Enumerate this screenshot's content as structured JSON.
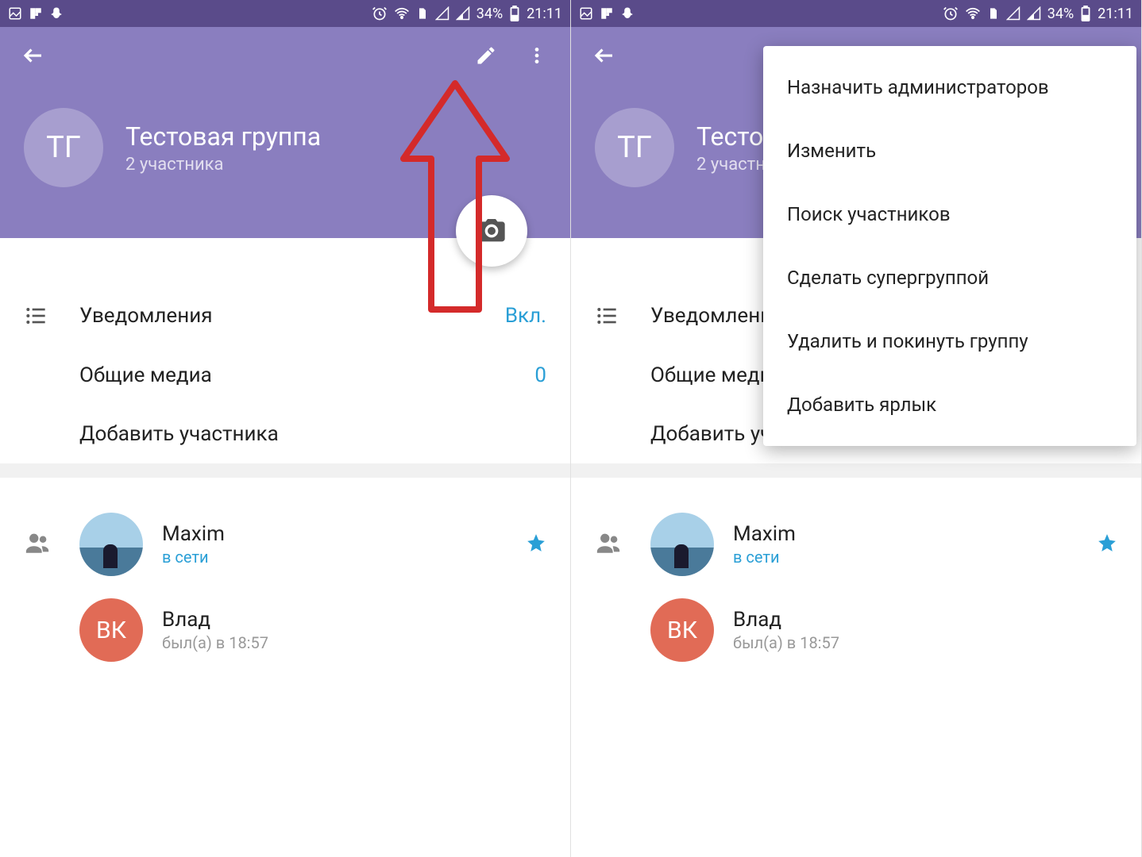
{
  "status": {
    "battery_pct": "34%",
    "time": "21:11"
  },
  "group": {
    "avatar_initials": "ТГ",
    "title": "Тестовая группа",
    "subtitle": "2 участника"
  },
  "options": {
    "notifications_label": "Уведомления",
    "notifications_value": "Вкл.",
    "shared_media_label": "Общие медиа",
    "shared_media_value": "0",
    "add_member_label": "Добавить участника"
  },
  "members": [
    {
      "name": "Maxim",
      "status": "в сети",
      "online": true,
      "starred": true,
      "avatar_type": "img",
      "initials": ""
    },
    {
      "name": "Влад",
      "status": "был(а) в 18:57",
      "online": false,
      "starred": false,
      "avatar_type": "red",
      "initials": "ВК"
    }
  ],
  "menu": {
    "items": [
      "Назначить администраторов",
      "Изменить",
      "Поиск участников",
      "Сделать супергруппой",
      "Удалить и покинуть группу",
      "Добавить ярлык"
    ]
  },
  "colors": {
    "header": "#8a7ebf",
    "status_bar": "#5a4b8a",
    "accent": "#2a9fd6",
    "annotation": "#d42a2a"
  }
}
